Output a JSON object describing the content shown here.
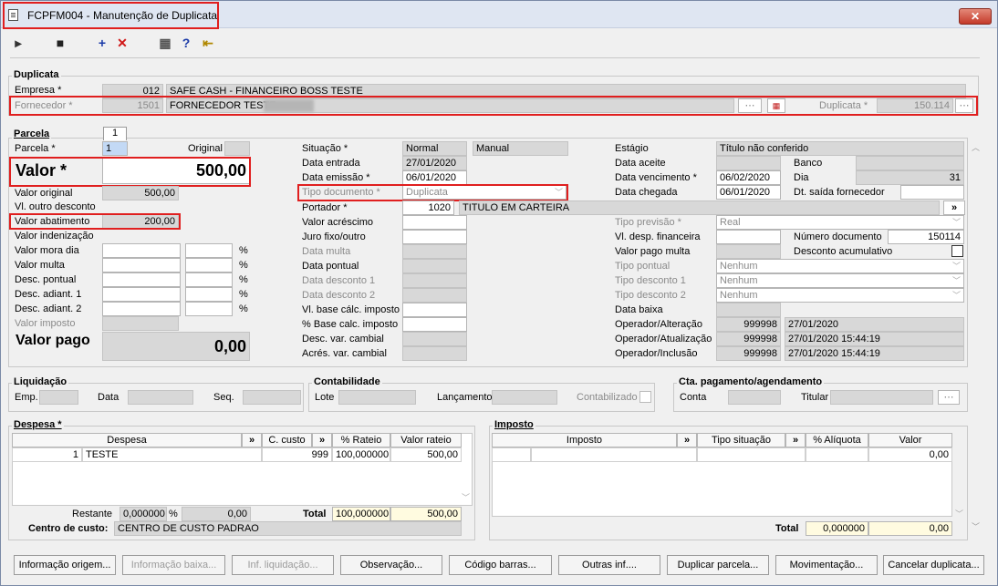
{
  "window": {
    "title": "FCPFM004 - Manutenção de Duplicata",
    "close": "✕"
  },
  "toolbar": [
    {
      "name": "cursor-icon",
      "glyph": "▸"
    },
    {
      "name": "save-icon",
      "glyph": "■"
    },
    {
      "name": "add-icon",
      "glyph": "+"
    },
    {
      "name": "delete-icon",
      "glyph": "✕"
    },
    {
      "name": "calculator-icon",
      "glyph": "▦"
    },
    {
      "name": "help-icon",
      "glyph": "?"
    },
    {
      "name": "exit-icon",
      "glyph": "⇤"
    }
  ],
  "duplicata": {
    "section": "Duplicata",
    "empresa_label": "Empresa *",
    "empresa_code": "012",
    "empresa_name": "SAFE CASH - FINANCEIRO BOSS TESTE",
    "fornecedor_label": "Fornecedor *",
    "fornecedor_code": "1501",
    "fornecedor_name": "FORNECEDOR TESTE",
    "duplicata_label": "Duplicata *",
    "duplicata_value": "150.114"
  },
  "parcela": {
    "section": "Parcela",
    "tab": "1",
    "parcela_label": "Parcela *",
    "parcela_value": "1",
    "original_label": "Original",
    "valor_label": "Valor *",
    "valor_value": "500,00",
    "valor_original_label": "Valor original",
    "valor_original_value": "500,00",
    "vl_outro_desconto_label": "Vl. outro desconto",
    "valor_abatimento_label": "Valor abatimento",
    "valor_abatimento_value": "200,00",
    "valor_indenizacao_label": "Valor indenização",
    "valor_mora_dia_label": "Valor mora dia",
    "valor_multa_label": "Valor multa",
    "desc_pontual_label": "Desc. pontual",
    "desc_adiant1_label": "Desc. adiant. 1",
    "desc_adiant2_label": "Desc. adiant. 2",
    "percent": "%",
    "valor_imposto_label": "Valor imposto",
    "valor_pago_label": "Valor pago",
    "valor_pago_value": "0,00",
    "situacao_label": "Situação *",
    "situacao_value": "Normal",
    "situacao_extra": "Manual",
    "data_entrada_label": "Data entrada",
    "data_entrada_value": "27/01/2020",
    "data_emissao_label": "Data emissão *",
    "data_emissao_value": "06/01/2020",
    "tipo_documento_label": "Tipo documento *",
    "tipo_documento_value": "Duplicata",
    "portador_label": "Portador *",
    "portador_code": "1020",
    "portador_name": "TITULO EM CARTEIRA",
    "valor_acrescimo_label": "Valor acréscimo",
    "juro_fixo_label": "Juro fixo/outro",
    "data_multa_label": "Data multa",
    "data_pontual_label": "Data pontual",
    "data_desconto1_label": "Data desconto 1",
    "data_desconto2_label": "Data desconto 2",
    "vl_base_calc_imposto_label": "Vl. base cálc. imposto",
    "pct_base_calc_imposto_label": "% Base calc. imposto",
    "desc_var_cambial_label": "Desc. var. cambial",
    "acres_var_cambial_label": "Acrés. var. cambial",
    "estagio_label": "Estágio",
    "estagio_value": "Título não conferido",
    "data_aceite_label": "Data aceite",
    "banco_label": "Banco",
    "data_vencimento_label": "Data vencimento *",
    "data_vencimento_value": "06/02/2020",
    "dia_label": "Dia",
    "dia_value": "31",
    "data_chegada_label": "Data chegada",
    "data_chegada_value": "06/01/2020",
    "dt_saida_label": "Dt. saída fornecedor",
    "tipo_previsao_label": "Tipo previsão *",
    "tipo_previsao_value": "Real",
    "vl_desp_financeira_label": "Vl. desp. financeira",
    "numero_documento_label": "Número documento",
    "numero_documento_value": "150114",
    "valor_pago_multa_label": "Valor pago multa",
    "desconto_acumulativo_label": "Desconto acumulativo",
    "tipo_pontual_label": "Tipo pontual",
    "tipo_pontual_value": "Nenhum",
    "tipo_desconto1_label": "Tipo desconto 1",
    "tipo_desconto1_value": "Nenhum",
    "tipo_desconto2_label": "Tipo desconto 2",
    "tipo_desconto2_value": "Nenhum",
    "data_baixa_label": "Data baixa",
    "op_alteracao_label": "Operador/Alteração",
    "op_alteracao_code": "999998",
    "op_alteracao_date": "27/01/2020",
    "op_atualizacao_label": "Operador/Atualização",
    "op_atualizacao_code": "999998",
    "op_atualizacao_date": "27/01/2020 15:44:19",
    "op_inclusao_label": "Operador/Inclusão",
    "op_inclusao_code": "999998",
    "op_inclusao_date": "27/01/2020 15:44:19"
  },
  "liquidacao": {
    "section": "Liquidação",
    "emp_label": "Emp.",
    "data_label": "Data",
    "seq_label": "Seq."
  },
  "contabilidade": {
    "section": "Contabilidade",
    "lote_label": "Lote",
    "lancamento_label": "Lançamento",
    "contabilizado_label": "Contabilizado"
  },
  "cta_pagamento": {
    "section": "Cta. pagamento/agendamento",
    "conta_label": "Conta",
    "titular_label": "Titular"
  },
  "despesa": {
    "section": "Despesa *",
    "columns": [
      "Despesa",
      "»",
      "C. custo",
      "»",
      "% Rateio",
      "Valor rateio"
    ],
    "rows": [
      {
        "code": "1",
        "name": "TESTE",
        "ccusto": "999",
        "rateio": "100,000000",
        "valor": "500,00"
      }
    ],
    "restante_label": "Restante",
    "restante_pct": "0,000000",
    "restante_pct_sign": "%",
    "restante_valor": "0,00",
    "total_label": "Total",
    "total_pct": "100,000000",
    "total_valor": "500,00",
    "centro_custo_label": "Centro de custo:",
    "centro_custo_value": "CENTRO DE CUSTO PADRAO"
  },
  "imposto": {
    "section": "Imposto",
    "columns": [
      "Imposto",
      "»",
      "Tipo situação",
      "»",
      "% Alíquota",
      "Valor"
    ],
    "row_valor": "0,00",
    "total_label": "Total",
    "total_pct": "0,000000",
    "total_valor": "0,00"
  },
  "buttons": [
    {
      "label": "Informação origem...",
      "enabled": true
    },
    {
      "label": "Informação baixa...",
      "enabled": false
    },
    {
      "label": "Inf. liquidação...",
      "enabled": false
    },
    {
      "label": "Observação...",
      "enabled": true
    },
    {
      "label": "Código barras...",
      "enabled": true
    },
    {
      "label": "Outras inf....",
      "enabled": true
    },
    {
      "label": "Duplicar parcela...",
      "enabled": true
    },
    {
      "label": "Movimentação...",
      "enabled": true
    },
    {
      "label": "Cancelar duplicata...",
      "enabled": true
    }
  ],
  "colors": {
    "highlight": "#e01f1f",
    "titlebar": "#dfe6f2",
    "field_disabled": "#d8d8d8",
    "total_bg": "#fffbe0"
  }
}
